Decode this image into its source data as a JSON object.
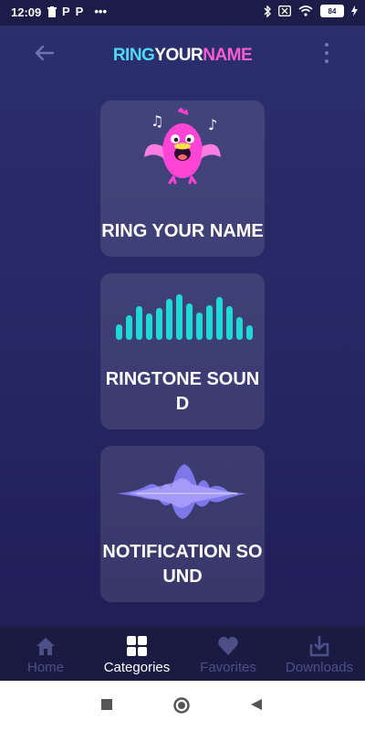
{
  "status_bar": {
    "time": "12:09",
    "left_icons": [
      "trash-icon",
      "p-icon",
      "p-icon",
      "more-dots-icon"
    ],
    "right_icons": [
      "bluetooth-icon",
      "sim-icon",
      "wifi-icon",
      "battery-icon",
      "charging-icon"
    ],
    "battery_level": "84"
  },
  "header": {
    "title_part1": "RING",
    "title_part2": "YOUR",
    "title_part3": "NAME",
    "colors": {
      "ring": "#4fd9f5",
      "your": "#ffffff",
      "name": "#ff5bd3"
    }
  },
  "categories": [
    {
      "label": "RING YOUR NAME",
      "icon": "singing-bird-icon"
    },
    {
      "label": "RINGTONE SOUND",
      "icon": "equalizer-bars-icon"
    },
    {
      "label": "NOTIFICATION SOUND",
      "icon": "sound-wave-icon"
    }
  ],
  "bottom_nav": [
    {
      "label": "Home",
      "icon": "home-icon",
      "active": false
    },
    {
      "label": "Categories",
      "icon": "grid-icon",
      "active": true
    },
    {
      "label": "Favorites",
      "icon": "heart-icon",
      "active": false
    },
    {
      "label": "Downloads",
      "icon": "download-icon",
      "active": false
    }
  ],
  "system_nav": [
    "square-recents-icon",
    "circle-home-icon",
    "triangle-back-icon"
  ]
}
